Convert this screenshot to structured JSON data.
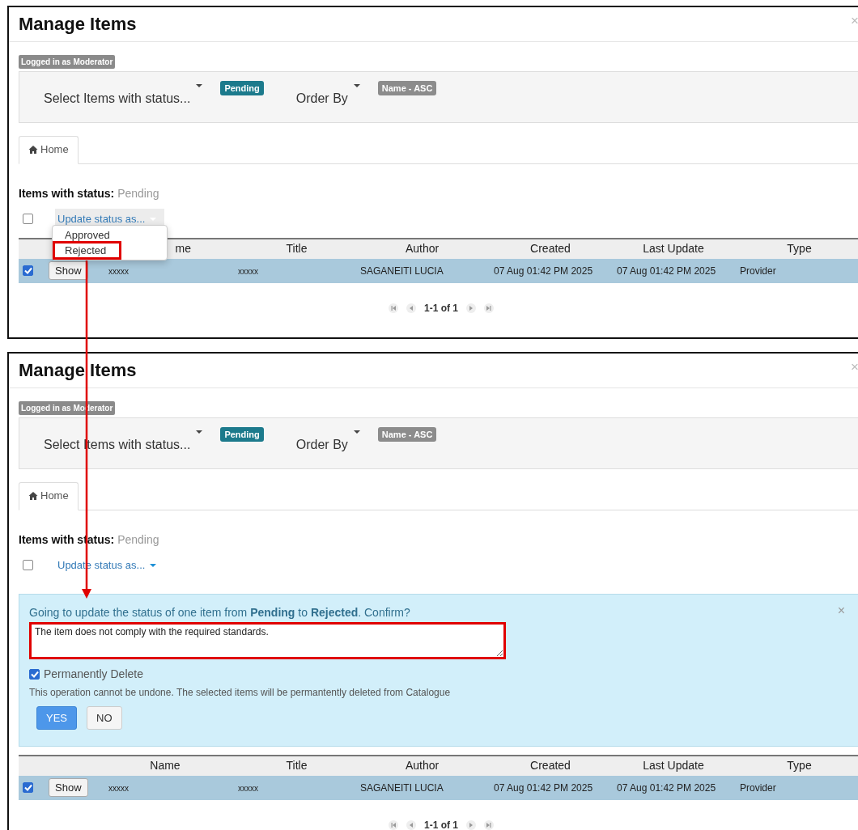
{
  "panels": [
    {
      "title": "Manage Items",
      "close": "×",
      "user_badge": "Logged in as Moderator",
      "filters": {
        "status_label": "Select Items with status...",
        "status_value": "Pending",
        "order_label": "Order By",
        "order_value": "Name - ASC"
      },
      "tabs": [
        {
          "label": "Home",
          "selected": true
        }
      ],
      "status_heading": {
        "label": "Items with status:",
        "value": "Pending"
      },
      "bulk": {
        "checked": false,
        "action": "Update status as...",
        "open": true,
        "menu": [
          {
            "label": "Approved",
            "highlighted": false
          },
          {
            "label": "Rejected",
            "highlighted": true
          }
        ]
      },
      "table": {
        "columns": [
          "me",
          "Title",
          "Author",
          "Created",
          "Last Update",
          "Type"
        ],
        "rows": [
          {
            "checked": true,
            "action": "Show",
            "cells": [
              "xxxxx",
              "xxxxx",
              "SAGANEITI LUCIA",
              "07 Aug 01:42 PM 2025",
              "07 Aug 01:42 PM 2025",
              "Provider"
            ]
          }
        ]
      },
      "pager": "1-1 of 1"
    },
    {
      "title": "Manage Items",
      "close": "×",
      "user_badge": "Logged in as Moderator",
      "filters": {
        "status_label": "Select Items with status...",
        "status_value": "Pending",
        "order_label": "Order By",
        "order_value": "Name - ASC"
      },
      "tabs": [
        {
          "label": "Home",
          "selected": true
        }
      ],
      "status_heading": {
        "label": "Items with status:",
        "value": "Pending"
      },
      "bulk": {
        "checked": false,
        "action": "Update status as...",
        "open": false
      },
      "confirm": {
        "message": "Going to update the status of one item from **Pending** to **Rejected**. Confirm?",
        "close": "×",
        "reason": "The item does not comply with the required standards.",
        "reason_highlighted": true,
        "delete_checked": true,
        "delete_label": "Permanently Delete",
        "warning": "This operation cannot be undone. The selected items will be permantently deleted from Catalogue",
        "buttons": [
          {
            "label": "YES",
            "kind": "primary"
          },
          {
            "label": "NO",
            "kind": "default"
          }
        ]
      },
      "table": {
        "columns": [
          "Name",
          "Title",
          "Author",
          "Created",
          "Last Update",
          "Type"
        ],
        "rows": [
          {
            "checked": true,
            "action": "Show",
            "cells": [
              "xxxxx",
              "xxxxx",
              "SAGANEITI LUCIA",
              "07 Aug 01:42 PM 2025",
              "07 Aug 01:42 PM 2025",
              "Provider"
            ]
          }
        ]
      },
      "pager": "1-1 of 1"
    }
  ]
}
